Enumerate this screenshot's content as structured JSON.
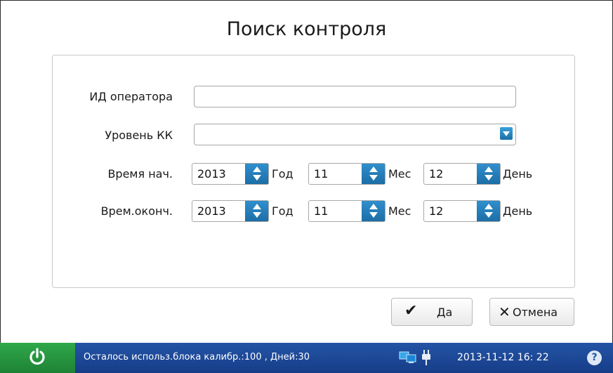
{
  "title": "Поиск контроля",
  "form": {
    "operator_id": {
      "label": "ИД оператора",
      "value": ""
    },
    "qc_level": {
      "label": "Уровень КК",
      "value": ""
    },
    "start": {
      "label": "Время нач.",
      "year": "2013",
      "month": "11",
      "day": "12"
    },
    "end": {
      "label": "Врем.оконч.",
      "year": "2013",
      "month": "11",
      "day": "12"
    },
    "units": {
      "year": "Год",
      "month": "Мес",
      "day": "День"
    }
  },
  "buttons": {
    "ok": "Да",
    "cancel": "Отмена"
  },
  "statusbar": {
    "message": "Осталось использ.блока калибр.:100 , Дней:30",
    "datetime": "2013-11-12  16: 22",
    "help": "?"
  },
  "icons": {
    "power": "power-icon",
    "network": "network-icon",
    "plug": "plug-icon",
    "help": "help-icon",
    "check": "check-icon",
    "close": "close-icon",
    "dropdown": "chevron-down-icon"
  },
  "colors": {
    "status_bar": "#1e4a98",
    "power_button": "#27983f",
    "spinner": "#2680c0"
  }
}
